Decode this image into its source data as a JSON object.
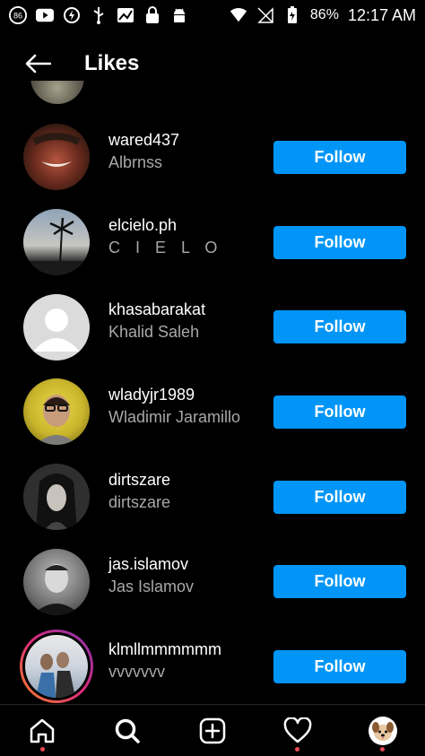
{
  "status_bar": {
    "notification_count": "86",
    "battery": "86%",
    "time": "12:17 AM"
  },
  "header": {
    "title": "Likes"
  },
  "likes": [
    {
      "username": "wared437",
      "fullname": "Albrnss",
      "button": "Follow"
    },
    {
      "username": "elcielo.ph",
      "fullname": "C I E L O",
      "button": "Follow"
    },
    {
      "username": "khasabarakat",
      "fullname": "Khalid Saleh",
      "button": "Follow"
    },
    {
      "username": "wladyjr1989",
      "fullname": "Wladimir Jaramillo",
      "button": "Follow"
    },
    {
      "username": "dirtszare",
      "fullname": "dirtszare",
      "button": "Follow"
    },
    {
      "username": "jas.islamov",
      "fullname": "Jas Islamov",
      "button": "Follow"
    },
    {
      "username": "klmllmmmmmm",
      "fullname": "vvvvvvv",
      "button": "Follow"
    }
  ],
  "colors": {
    "accent": "#0095f6",
    "notification_dot": "#ed4956"
  },
  "bottom_nav": [
    "home-icon",
    "search-icon",
    "new-post-icon",
    "heart-icon",
    "profile-avatar"
  ]
}
